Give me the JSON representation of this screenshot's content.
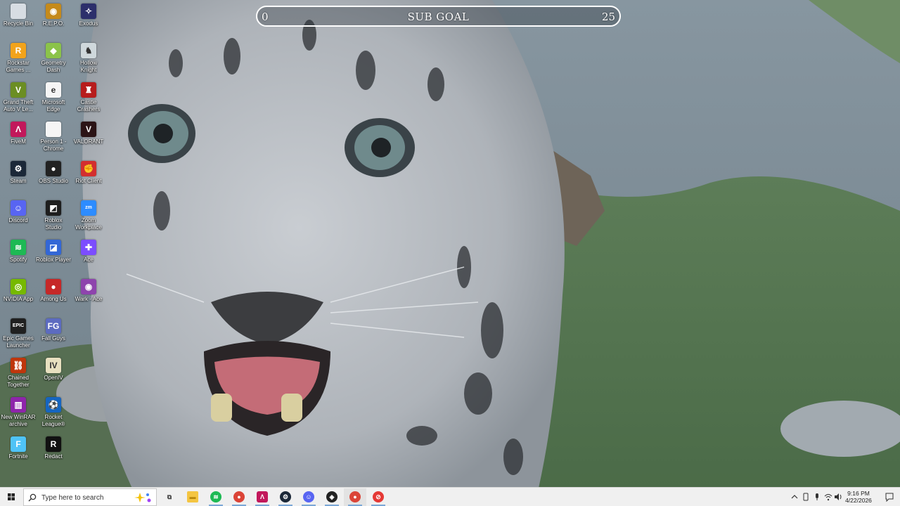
{
  "subgoal": {
    "min": "0",
    "title": "SUB GOAL",
    "max": "25"
  },
  "desktop": {
    "icons": [
      {
        "label": "Recycle Bin",
        "icon": "recycle-bin-icon",
        "glyph": "",
        "color": "#d7dde3"
      },
      {
        "label": "R.E.P.O.",
        "icon": "repo-icon",
        "glyph": "◉",
        "color": "#c58a1b"
      },
      {
        "label": "Exodus",
        "icon": "exodus-icon",
        "glyph": "✧",
        "color": "#2c2f6b"
      },
      {
        "label": "Rockstar\nGames ...",
        "icon": "rockstar-icon",
        "glyph": "R",
        "color": "#f2a31b"
      },
      {
        "label": "Geometry\nDash",
        "icon": "geometry-dash-icon",
        "glyph": "◆",
        "color": "#8bc34a"
      },
      {
        "label": "Hollow\nKnight",
        "icon": "hollow-knight-icon",
        "glyph": "♞",
        "color": "#cfd8dc"
      },
      {
        "label": "Grand Theft\nAuto V Le...",
        "icon": "gta-v-icon",
        "glyph": "V",
        "color": "#6b8e23"
      },
      {
        "label": "Microsoft\nEdge",
        "icon": "edge-icon",
        "glyph": "e",
        "color": "#f5f5f5"
      },
      {
        "label": "Castle\nCrashers",
        "icon": "castle-crashers-icon",
        "glyph": "♜",
        "color": "#b71c1c"
      },
      {
        "label": "FiveM",
        "icon": "fivem-icon",
        "glyph": "Λ",
        "color": "#c2185b"
      },
      {
        "label": "Person 1 -\nChrome",
        "icon": "chrome-profile-icon",
        "glyph": "",
        "color": "#f5f5f5"
      },
      {
        "label": "VALORANT",
        "icon": "valorant-icon",
        "glyph": "V",
        "color": "#2b1416"
      },
      {
        "label": "Steam",
        "icon": "steam-icon",
        "glyph": "⚙",
        "color": "#1b2838"
      },
      {
        "label": "OBS Studio",
        "icon": "obs-icon",
        "glyph": "●",
        "color": "#222222"
      },
      {
        "label": "Riot Client",
        "icon": "riot-client-icon",
        "glyph": "✊",
        "color": "#d32f2f"
      },
      {
        "label": "Discord",
        "icon": "discord-icon",
        "glyph": "☺",
        "color": "#5865f2"
      },
      {
        "label": "Roblox\nStudio",
        "icon": "roblox-studio-icon",
        "glyph": "◩",
        "color": "#1e1e1e"
      },
      {
        "label": "Zoom\nWorkplace",
        "icon": "zoom-icon",
        "glyph": "zm",
        "color": "#2d8cff"
      },
      {
        "label": "Spotify",
        "icon": "spotify-icon",
        "glyph": "≋",
        "color": "#1db954"
      },
      {
        "label": "Roblox Player",
        "icon": "roblox-player-icon",
        "glyph": "◪",
        "color": "#3367d6"
      },
      {
        "label": "Ace",
        "icon": "ace-icon",
        "glyph": "✚",
        "color": "#7c4dff"
      },
      {
        "label": "NVIDIA App",
        "icon": "nvidia-icon",
        "glyph": "◎",
        "color": "#76b900"
      },
      {
        "label": "Among Us",
        "icon": "among-us-icon",
        "glyph": "●",
        "color": "#c62828"
      },
      {
        "label": "Wark - Ace",
        "icon": "wark-ace-icon",
        "glyph": "◉",
        "color": "#8e44ad"
      },
      {
        "label": "Epic Games\nLauncher",
        "icon": "epic-games-icon",
        "glyph": "EPIC",
        "color": "#202020"
      },
      {
        "label": "Fall Guys",
        "icon": "fall-guys-icon",
        "glyph": "FG",
        "color": "#5c6bc0"
      },
      {
        "label": "",
        "icon": "blank-icon",
        "glyph": "",
        "color": ""
      },
      {
        "label": "Chained\nTogether",
        "icon": "chained-together-icon",
        "glyph": "⛓",
        "color": "#bf360c"
      },
      {
        "label": "OpenIV",
        "icon": "openiv-icon",
        "glyph": "IV",
        "color": "#e8e0c0"
      },
      {
        "label": "",
        "icon": "blank-icon",
        "glyph": "",
        "color": ""
      },
      {
        "label": "New WinRAR\narchive",
        "icon": "winrar-icon",
        "glyph": "▥",
        "color": "#8e24aa"
      },
      {
        "label": "Rocket\nLeague®",
        "icon": "rocket-league-icon",
        "glyph": "⚽",
        "color": "#1565c0"
      },
      {
        "label": "",
        "icon": "blank-icon",
        "glyph": "",
        "color": ""
      },
      {
        "label": "Fortnite",
        "icon": "fortnite-icon",
        "glyph": "F",
        "color": "#4fc3f7"
      },
      {
        "label": "Redact",
        "icon": "redact-icon",
        "glyph": "R",
        "color": "#111111"
      }
    ]
  },
  "taskbar": {
    "search_placeholder": "Type here to search",
    "apps": [
      {
        "name": "taskview",
        "icon": "task-view-icon",
        "glyph": "⧉",
        "color": "#444444"
      },
      {
        "name": "explorer",
        "icon": "file-explorer-icon",
        "glyph": "▬",
        "color": "#f4c542"
      },
      {
        "name": "spotify",
        "icon": "spotify-icon",
        "glyph": "≋",
        "color": "#1db954"
      },
      {
        "name": "chrome",
        "icon": "chrome-icon",
        "glyph": "●",
        "color": "#db4437"
      },
      {
        "name": "fivem",
        "icon": "fivem-icon",
        "glyph": "Λ",
        "color": "#c2185b"
      },
      {
        "name": "steam",
        "icon": "steam-icon",
        "glyph": "⚙",
        "color": "#1b2838"
      },
      {
        "name": "discord",
        "icon": "discord-icon",
        "glyph": "☺",
        "color": "#5865f2"
      },
      {
        "name": "roblox",
        "icon": "roblox-icon",
        "glyph": "◈",
        "color": "#222222"
      },
      {
        "name": "chrome-2",
        "icon": "chrome-icon",
        "glyph": "●",
        "color": "#db4437"
      },
      {
        "name": "tracker",
        "icon": "screen-tracker-icon",
        "glyph": "⊘",
        "color": "#e53935"
      }
    ],
    "clock_time": "9:16 PM",
    "clock_date": "4/22/2026"
  },
  "colors": {
    "taskbar_bg": "#f0f0f0",
    "overlay_border": "#ffffff"
  }
}
